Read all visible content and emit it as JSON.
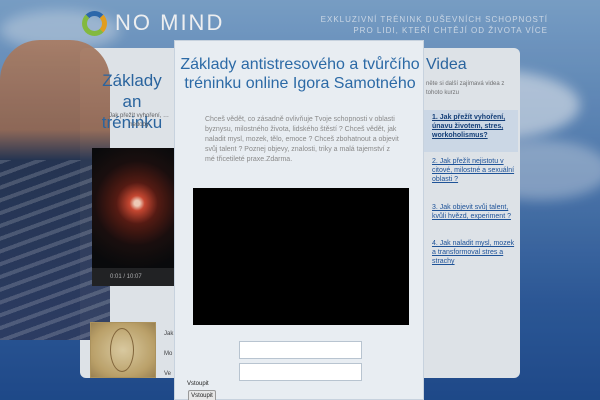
{
  "header": {
    "logo_text": "NO MIND",
    "tagline_line1": "EXKLUZIVNÍ TRÉNINK DUŠEVNÍCH SCHOPNOSTÍ",
    "tagline_line2": "PRO LIDI, KTEŘÍ CHTĚJÍ OD ŽIVOTA VÍCE"
  },
  "background_page": {
    "title": "Základy an tréninku",
    "intro_text": "Jak přežít vyhoření, … nedoby",
    "video_time": "0:01 / 10:07",
    "image_caption": "Jak Mo Ve"
  },
  "videa": {
    "title": "Videa",
    "intro": "něte si další zajímavá videa z tohoto kurzu",
    "items": [
      {
        "label": "1. Jak přežít vyhoření, únavu životem, stres, workoholismus?"
      },
      {
        "label": "2. Jak přežít nejistotu v citové, milostné a sexuální oblasti ?"
      },
      {
        "label": "3. Jak objevit svůj talent, kvůli hvězd, experiment ?"
      },
      {
        "label": "4. Jak naladit mysl, mozek a transformoval stres a strachy"
      }
    ]
  },
  "modal": {
    "title": "Základy antistresového a tvůrčího tréninku online Igora Samotného",
    "description": "Chceš vědět, co zásadně ovlivňuje Tvoje schopnosti v oblasti byznysu, milostného života, lidského štěstí ? Chceš vědět, jak naladit mysl, mozek, tělo, emoce ? Chceš zbohatnout a objevit svůj talent ? Poznej objevy, znalosti, triky a malá tajemství z mé třicetileté praxe.Zdarma.",
    "field1_value": "",
    "field2_value": ""
  },
  "login": {
    "label": "Vstoupit",
    "button_label": "Vstoupit"
  }
}
